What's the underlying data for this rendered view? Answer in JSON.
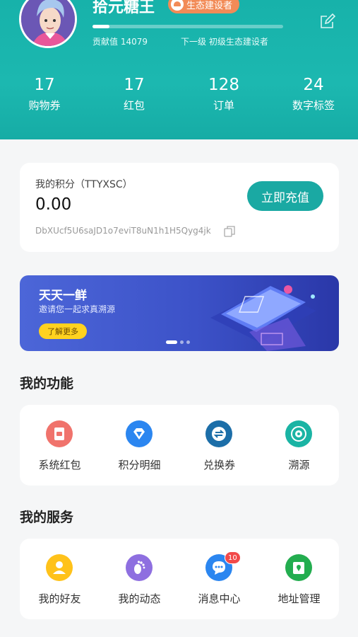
{
  "profile": {
    "username": "拾元糖王",
    "level_badge": "生态建设者",
    "contribution": "贡献值 14079",
    "next_level": "下一级  初级生态建设者",
    "progress_fraction": 0.09
  },
  "stats": [
    {
      "value": "17",
      "label": "购物券"
    },
    {
      "value": "17",
      "label": "红包"
    },
    {
      "value": "128",
      "label": "订单"
    },
    {
      "value": "24",
      "label": "数字标签"
    }
  ],
  "points": {
    "title": "我的积分（TTYXSC）",
    "value": "0.00",
    "address": "DbXUcf5U6saJD1o7eviT8uN1h1H5Qyg4jk",
    "recharge_label": "立即充值"
  },
  "banner": {
    "title": "天天一鲜",
    "subtitle": "邀请您一起求真溯源",
    "button_label": "了解更多",
    "active_slide": 1,
    "slide_count": 3
  },
  "functions": {
    "title": "我的功能",
    "items": [
      {
        "label": "系统红包",
        "icon": "red-envelope-icon",
        "color": "#f0736c"
      },
      {
        "label": "积分明细",
        "icon": "diamond-icon",
        "color": "#2b86f0"
      },
      {
        "label": "兑换券",
        "icon": "exchange-icon",
        "color": "#1c6ea8"
      },
      {
        "label": "溯源",
        "icon": "trace-icon",
        "color": "#1ab4a4"
      }
    ]
  },
  "services": {
    "title": "我的服务",
    "items": [
      {
        "label": "我的好友",
        "icon": "friend-icon",
        "color": "#ffc21a"
      },
      {
        "label": "我的动态",
        "icon": "footprint-icon",
        "color": "#8e6fe0"
      },
      {
        "label": "消息中心",
        "icon": "message-icon",
        "color": "#2b86f0",
        "badge": "10"
      },
      {
        "label": "地址管理",
        "icon": "address-icon",
        "color": "#23ad4f"
      }
    ]
  }
}
